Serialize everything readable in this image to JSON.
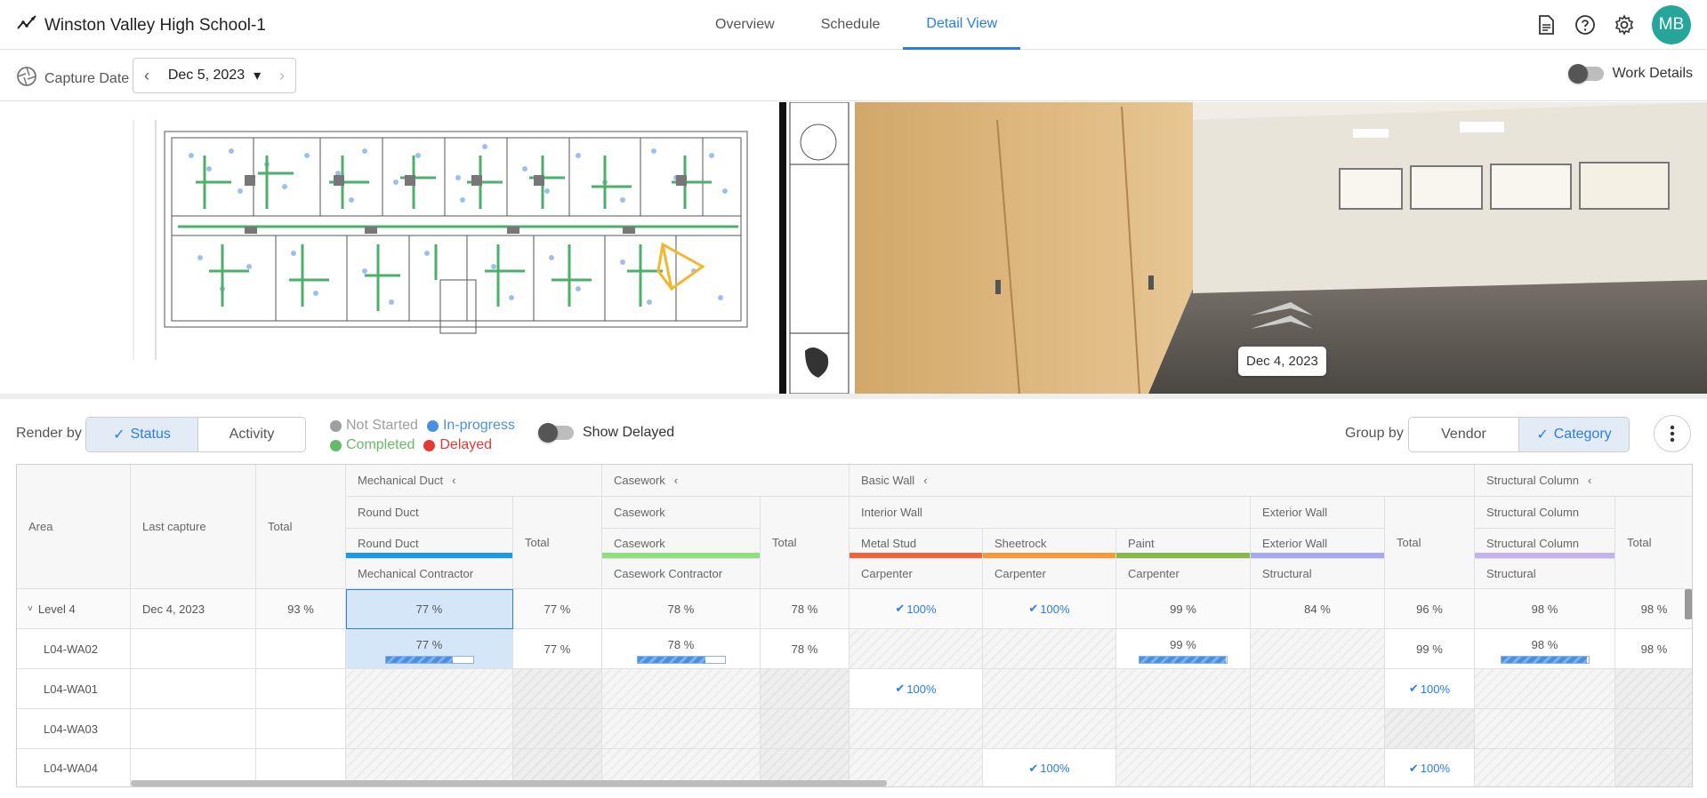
{
  "app": {
    "project_title": "Winston Valley High School-1"
  },
  "nav": {
    "tabs": [
      "Overview",
      "Schedule",
      "Detail View"
    ],
    "active": "Detail View"
  },
  "header_icons": [
    "document-icon",
    "help-icon",
    "gear-icon"
  ],
  "user": {
    "initials": "MB",
    "color": "#26a69a"
  },
  "capture": {
    "label": "Capture Date",
    "date": "Dec 5, 2023"
  },
  "work_details": {
    "label": "Work Details",
    "on": false
  },
  "photo": {
    "date_label": "Dec 4, 2023"
  },
  "render": {
    "label": "Render by",
    "options": [
      "Status",
      "Activity"
    ],
    "active": "Status"
  },
  "legend": {
    "items": [
      {
        "label": "Not Started",
        "color": "#9e9e9e"
      },
      {
        "label": "In-progress",
        "color": "#4a90e2"
      },
      {
        "label": "Completed",
        "color": "#66bb6a"
      },
      {
        "label": "Delayed",
        "color": "#e53935"
      }
    ]
  },
  "show_delayed": {
    "label": "Show Delayed",
    "on": false
  },
  "group": {
    "label": "Group by",
    "options": [
      "Vendor",
      "Category"
    ],
    "active": "Category"
  },
  "table": {
    "col_area": "Area",
    "col_last_capture": "Last capture",
    "col_total": "Total",
    "total_label": "Total",
    "groups": {
      "mech": {
        "title": "Mechanical Duct",
        "sub": "Round Duct",
        "item": "Round Duct",
        "vendor": "Mechanical Contractor",
        "color": "#1e9be0"
      },
      "case": {
        "title": "Casework",
        "sub": "Casework",
        "item": "Casework",
        "vendor": "Casework Contractor",
        "color": "#8ee07b"
      },
      "wall": {
        "title": "Basic Wall",
        "sub_int": "Interior Wall",
        "sub_ext": "Exterior Wall",
        "metal": "Metal Stud",
        "metal_color": "#f0643c",
        "sheet": "Sheetrock",
        "sheet_color": "#f39a3a",
        "paint": "Paint",
        "paint_color": "#86b84a",
        "ext": "Exterior Wall",
        "ext_color": "#a7a9ec",
        "v_carp": "Carpenter",
        "v_struct": "Structural"
      },
      "col": {
        "title": "Structural Column",
        "sub": "Structural Column",
        "item": "Structural Column",
        "vendor": "Structural",
        "color": "#c4b2ee"
      }
    },
    "rows": [
      {
        "area": "Level 4",
        "last": "Dec 4, 2023",
        "total": "93 %",
        "mech": "77 %",
        "mech_t": "77 %",
        "case": "78 %",
        "case_t": "78 %",
        "metal": "100%",
        "sheet": "100%",
        "paint": "99 %",
        "ext": "84 %",
        "wall_t": "96 %",
        "col": "98 %",
        "col_t": "98 %"
      },
      {
        "area": "L04-WA02",
        "mech": "77 %",
        "mech_p": 0.77,
        "mech_t": "77 %",
        "case": "78 %",
        "case_p": 0.78,
        "case_t": "78 %",
        "paint": "99 %",
        "paint_p": 0.99,
        "wall_t": "99 %",
        "col": "98 %",
        "col_p": 0.98,
        "col_t": "98 %"
      },
      {
        "area": "L04-WA01",
        "metal": "100%",
        "wall_t": "100%"
      },
      {
        "area": "L04-WA03"
      },
      {
        "area": "L04-WA04",
        "sheet": "100%",
        "wall_t": "100%"
      }
    ]
  }
}
